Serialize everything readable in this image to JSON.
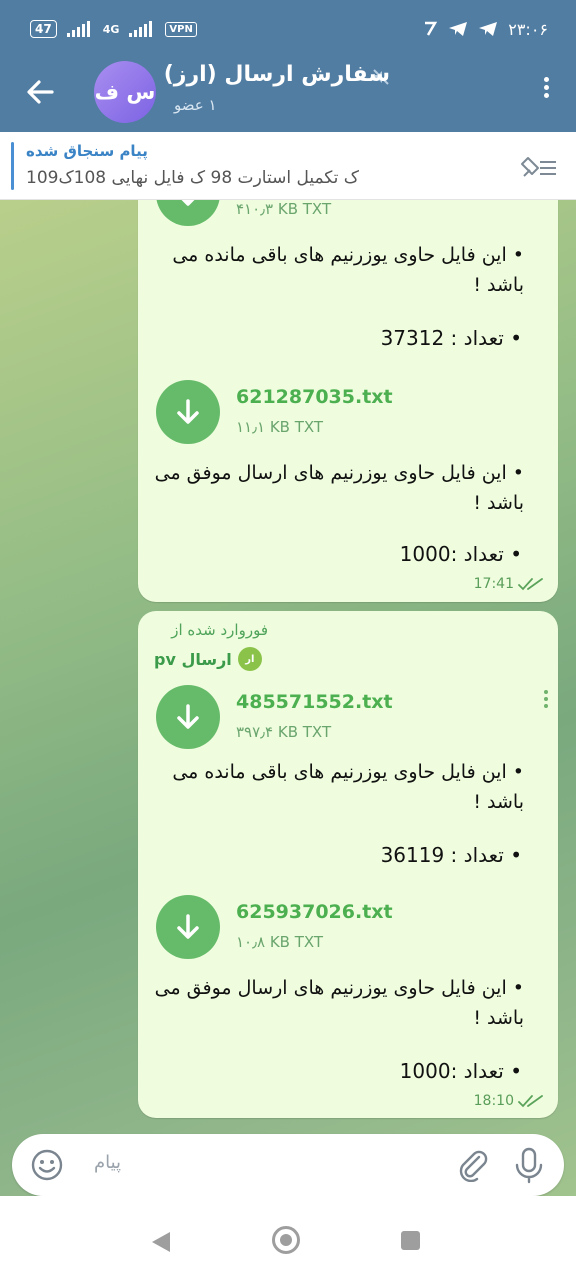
{
  "status_bar": {
    "battery": "47",
    "network": "4G",
    "vpn": "VPN",
    "time": "۲۳:۰۶"
  },
  "header": {
    "avatar_initials": "س ف",
    "title": "سفارش ارسال (ارز)",
    "subtitle": "۱ عضو"
  },
  "pinned": {
    "title": "پیام سنجاق شده",
    "text": "109ک تکمیل   استارت 98 ک   فایل نهایی 108ک"
  },
  "messages": [
    {
      "files": [
        {
          "name": "",
          "size": "۴۱۰٫۳ KB TXT",
          "description": "• این فایل حاوی یوزرنیم های باقی مانده می باشد !",
          "count": "• تعداد : 37312"
        },
        {
          "name": "621287035.txt",
          "size": "۱۱٫۱ KB TXT",
          "description": "• این فایل حاوی یوزرنیم های ارسال موفق می باشد !",
          "count": "• تعداد :1000"
        }
      ],
      "time": "17:41"
    },
    {
      "forwarded_label": "فوروارد شده از",
      "forwarded_from": "ارسال pv",
      "forwarded_avatar": "ار",
      "files": [
        {
          "name": "485571552.txt",
          "size": "۳۹۷٫۴ KB TXT",
          "description": "• این فایل حاوی یوزرنیم های باقی مانده می باشد !",
          "count": "• تعداد : 36119"
        },
        {
          "name": "625937026.txt",
          "size": "۱۰٫۸ KB TXT",
          "description": "• این فایل حاوی یوزرنیم های ارسال موفق می باشد !",
          "count": "• تعداد :1000"
        }
      ],
      "time": "18:10"
    }
  ],
  "input": {
    "placeholder": "پیام"
  },
  "icons": {
    "back": "back-arrow-icon",
    "mute": "mute-icon",
    "menu": "more-vert-icon",
    "pin": "unpin-icon",
    "download": "download-arrow-icon",
    "read": "double-check-icon",
    "emoji": "emoji-icon",
    "attach": "paperclip-icon",
    "mic": "microphone-icon"
  },
  "colors": {
    "header": "#517da2",
    "bubble": "#effdde",
    "accent_green": "#4caf50",
    "pin_blue": "#3a84c6"
  }
}
